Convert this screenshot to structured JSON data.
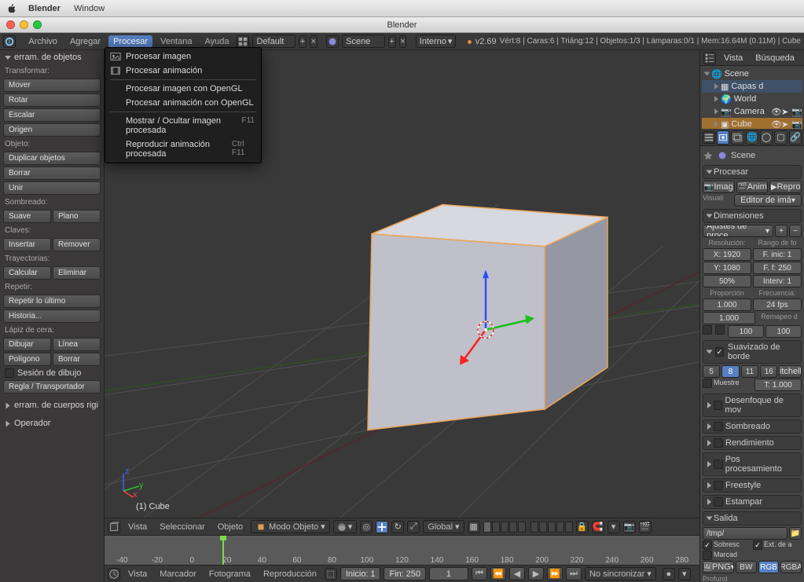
{
  "mac": {
    "app": "Blender",
    "menu_window": "Window"
  },
  "window_title": "Blender",
  "info": {
    "menus": [
      "Archivo",
      "Agregar",
      "Procesar",
      "Ventana",
      "Ayuda"
    ],
    "active_menu_index": 2,
    "layout": "Default",
    "scene": "Scene",
    "engine": "Interno",
    "version": "v2.69",
    "stats": "Vért:8 | Caras:6 | Triáng:12 | Objetos:1/3 | Lámparas:0/1 | Mem:16.64M (0.11M) | Cube"
  },
  "dropdown": {
    "items": [
      {
        "label": "Procesar imagen",
        "icon": "photo"
      },
      {
        "label": "Procesar animación",
        "icon": "film"
      },
      {
        "sep": true
      },
      {
        "label": "Procesar imagen con OpenGL"
      },
      {
        "label": "Procesar animación con OpenGL"
      },
      {
        "sep": true
      },
      {
        "label": "Mostrar / Ocultar imagen procesada",
        "key": "F11"
      },
      {
        "label": "Reproducir animación procesada",
        "key": "Ctrl F11"
      }
    ]
  },
  "toolshelf": {
    "header": "erram. de objetos",
    "groups": [
      {
        "label": "Transformar:",
        "buttons": [
          [
            "Mover"
          ],
          [
            "Rotar"
          ],
          [
            "Escalar"
          ],
          [
            "Origen"
          ]
        ]
      },
      {
        "label": "Objeto:",
        "buttons": [
          [
            "Duplicar objetos"
          ],
          [
            "Borrar"
          ],
          [
            "Unir"
          ]
        ]
      },
      {
        "label": "Sombreado:",
        "buttons": [
          [
            "Suave",
            "Plano"
          ]
        ]
      },
      {
        "label": "Claves:",
        "buttons": [
          [
            "Insertar",
            "Remover"
          ]
        ]
      },
      {
        "label": "Trayectorias:",
        "buttons": [
          [
            "Calcular",
            "Eliminar"
          ]
        ]
      },
      {
        "label": "Repetir:",
        "buttons": [
          [
            "Repetir lo último"
          ],
          [
            "Historia..."
          ]
        ]
      },
      {
        "label": "Lápiz de cera:",
        "buttons": [
          [
            "Dibujar",
            "Línea"
          ],
          [
            "Polígono",
            "Borrar"
          ]
        ]
      }
    ],
    "grease_check": "Sesión de dibujo",
    "ruler": "Regla / Transportador",
    "rigid": "erram. de cuerpos rigi",
    "operator": "Operador"
  },
  "viewport": {
    "object": "(1) Cube"
  },
  "viewheader": {
    "menus": [
      "Vista",
      "Seleccionar",
      "Objeto"
    ],
    "mode": "Modo Objeto",
    "orient": "Global"
  },
  "timeline": {
    "ticks": [
      -40,
      -20,
      0,
      20,
      40,
      60,
      80,
      100,
      120,
      140,
      160,
      180,
      200,
      220,
      240,
      260,
      280
    ],
    "current": 1,
    "menus": [
      "Vista",
      "Marcador",
      "Fotograma",
      "Reproducción"
    ],
    "start_lbl": "Inicio:",
    "start": 1,
    "end_lbl": "Fin:",
    "end": 250,
    "cur": 1,
    "sync": "No sincronizar"
  },
  "outliner": {
    "search": "Búsqueda",
    "view": "Vista",
    "items": [
      {
        "label": "Scene",
        "icon": "scene",
        "depth": 0,
        "open": true
      },
      {
        "label": "Capas d",
        "icon": "layers",
        "depth": 1,
        "sel": true
      },
      {
        "label": "World",
        "icon": "world",
        "depth": 1
      },
      {
        "label": "Camera",
        "icon": "camera",
        "depth": 1,
        "icons": true
      },
      {
        "label": "Cube",
        "icon": "mesh",
        "depth": 1,
        "icons": true,
        "hi": true
      }
    ]
  },
  "props": {
    "breadcrumb": "Scene",
    "procesar": {
      "title": "Procesar",
      "b1": "Imag",
      "b2": "Anim",
      "b3": "Repro",
      "vis_lbl": "Visuali",
      "vis": "Editor de imá"
    },
    "dimensions": {
      "title": "Dimensiones",
      "preset": "Ajustes de proce",
      "res_lbl": "Resolución:",
      "range_lbl": "Rango de fo",
      "x": "X: 1920",
      "y": "Y: 1080",
      "pct": "50%",
      "fi": "F. inic: 1",
      "ff": "F. f: 250",
      "interv": "Interv: 1",
      "prop_lbl": "Proporción",
      "freq_lbl": "Frecuencia:",
      "px": "1.000",
      "py": "1.000",
      "fps": "24 fps",
      "remap": "Remapeo d"
    },
    "aa": {
      "title": "Suavizado de borde",
      "samples": [
        "5",
        "8",
        "11",
        "16"
      ],
      "sel": 1,
      "filter": "Mitchell-",
      "muestre": "Muestre",
      "t": "T: 1.000"
    },
    "panels": [
      "Desenfoque de mov",
      "Sombreado",
      "Rendimiento",
      "Pos procesamiento",
      "Freestyle",
      "Estampar"
    ],
    "output": {
      "title": "Salida",
      "path": "/tmp/",
      "over": "Sobresc",
      "ext": "Ext. de a",
      "marcad": "Marcad",
      "fmt": "PNG",
      "bw": "BW",
      "rgb": "RGB",
      "rgba": "RGBA",
      "depth": "Profund"
    }
  }
}
